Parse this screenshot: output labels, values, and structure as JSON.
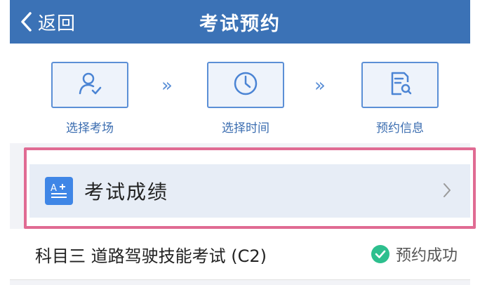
{
  "header": {
    "back_label": "返回",
    "title": "考试预约",
    "background": "#3b72b6"
  },
  "steps": [
    {
      "label": "选择考场",
      "icon": "person-check-icon"
    },
    {
      "label": "选择时间",
      "icon": "clock-icon"
    },
    {
      "label": "预约信息",
      "icon": "document-search-icon"
    }
  ],
  "step_arrow": "»",
  "score_entry": {
    "label": "考试成绩",
    "icon": "score-report-icon",
    "icon_color": "#3f86e6",
    "highlight_color": "#e06b93"
  },
  "exam": {
    "name": "科目三 道路驾驶技能考试 (C2)",
    "status": "预约成功",
    "status_color": "#2dbf8e"
  }
}
